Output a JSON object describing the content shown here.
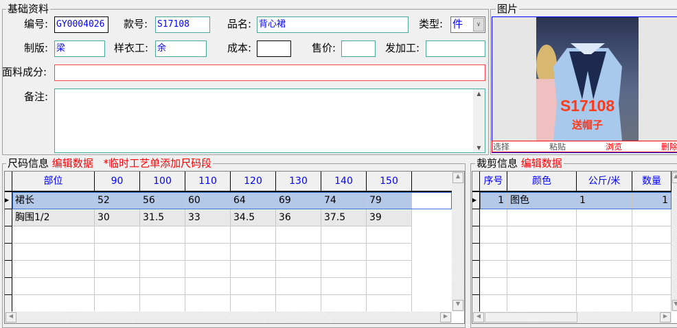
{
  "basic": {
    "legend": "基础资料",
    "code_label": "编号:",
    "code": "GY0004026",
    "style_label": "款号:",
    "style": "S17108",
    "name_label": "品名:",
    "name": "背心裙",
    "type_label": "类型:",
    "type": "件",
    "pattern_label": "制版:",
    "pattern": "梁",
    "sample_label": "样衣工:",
    "sample": "余",
    "cost_label": "成本:",
    "cost": "",
    "price_label": "售价:",
    "price": "",
    "process_label": "发加工:",
    "process": "",
    "fabric_label": "面料成分:",
    "fabric": "",
    "remark_label": "备注:",
    "remark": ""
  },
  "picture": {
    "legend": "图片",
    "overlay_code": "S17108",
    "overlay_note": "送帽子",
    "buttons": {
      "select": "选择",
      "paste": "粘贴",
      "browse": "浏览",
      "delete": "删除"
    }
  },
  "size": {
    "legend": "尺码信息",
    "edit": "编辑数据",
    "note": "*临时工艺单添加尺码段",
    "columns": [
      "部位",
      "90",
      "100",
      "110",
      "120",
      "130",
      "140",
      "150"
    ],
    "rows": [
      [
        "裙长",
        "52",
        "56",
        "60",
        "64",
        "69",
        "74",
        "79"
      ],
      [
        "胸围1/2",
        "30",
        "31.5",
        "33",
        "34.5",
        "36",
        "37.5",
        "39"
      ]
    ],
    "selected_row": 0
  },
  "cut": {
    "legend": "裁剪信息",
    "edit": "编辑数据",
    "columns": [
      "序号",
      "颜色",
      "公斤/米",
      "数量"
    ],
    "rows": [
      [
        "1",
        "图色",
        "1",
        "1"
      ]
    ],
    "selected_row": 0
  }
}
